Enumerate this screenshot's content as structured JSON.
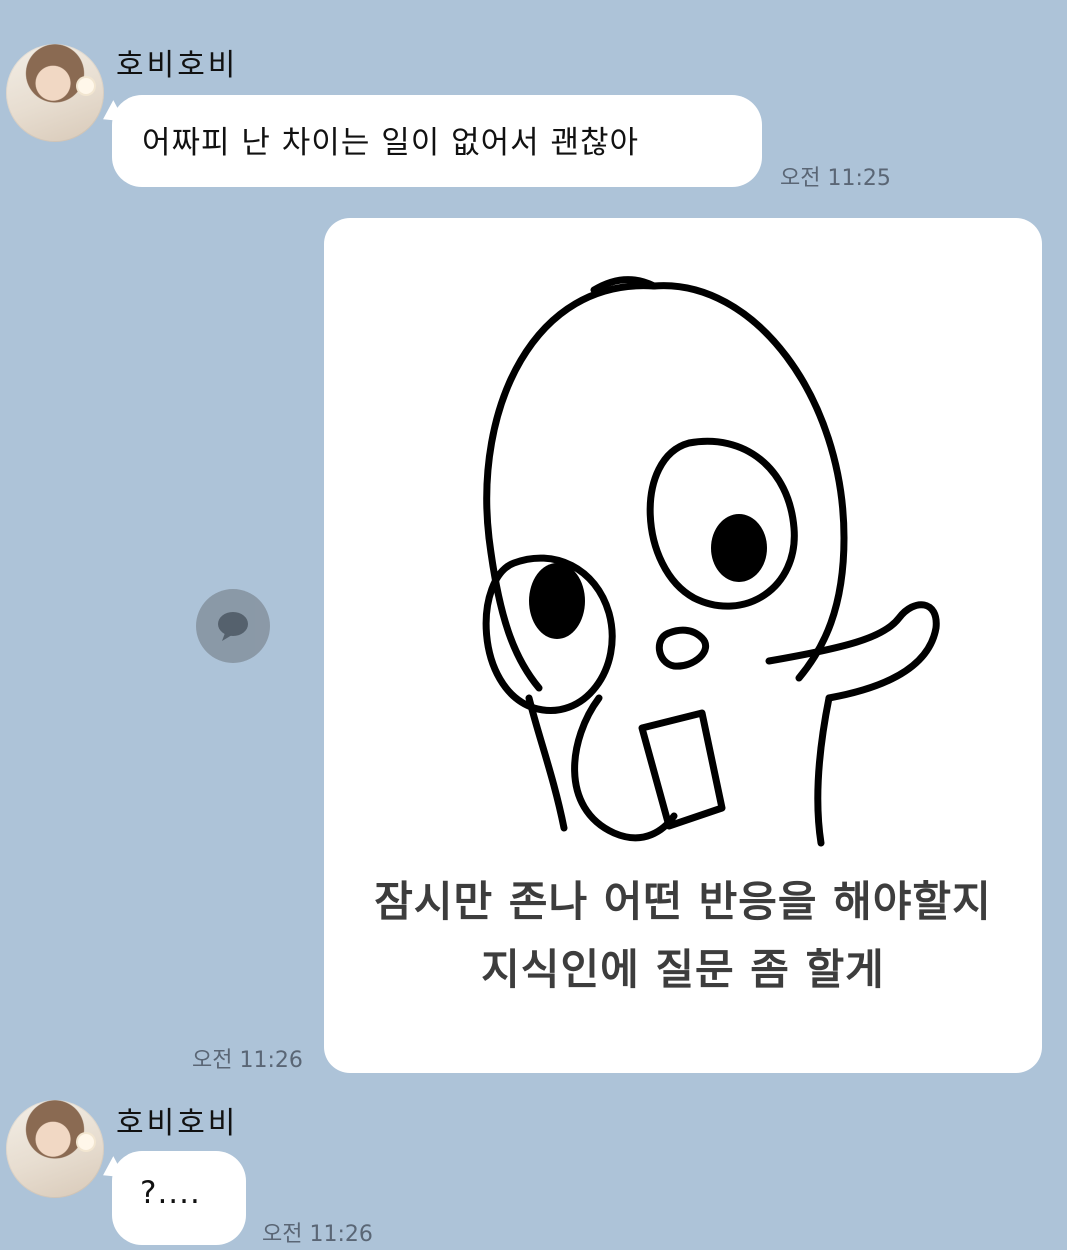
{
  "messages": [
    {
      "sender": "호비호비",
      "text": "어짜피 난 차이는 일이 없어서 괜찮아",
      "time": "오전 11:25"
    },
    {
      "image_caption_line1": "잠시만 존나 어떤 반응을 해야할지",
      "image_caption_line2": "지식인에 질문 좀 할게",
      "time": "오전 11:26"
    },
    {
      "sender": "호비호비",
      "text": "?....",
      "time": "오전 11:26"
    }
  ],
  "icons": {
    "share": "speech-bubble-icon"
  },
  "colors": {
    "background": "#adc3d8",
    "bubble": "#ffffff",
    "timestamp": "#5a6675"
  }
}
